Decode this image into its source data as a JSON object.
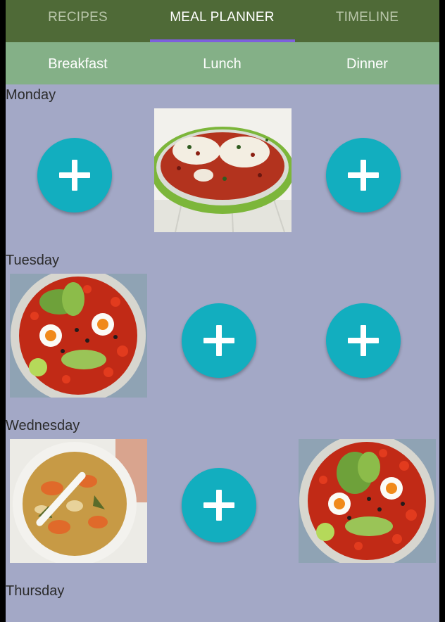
{
  "tabs": [
    {
      "label": "RECIPES",
      "active": false
    },
    {
      "label": "MEAL PLANNER",
      "active": true
    },
    {
      "label": "TIMELINE",
      "active": false
    }
  ],
  "meals": [
    "Breakfast",
    "Lunch",
    "Dinner"
  ],
  "days": [
    {
      "name": "Monday",
      "slots": [
        "add-icon",
        "fish-stew-photo",
        "add-icon"
      ]
    },
    {
      "name": "Tuesday",
      "slots": [
        "shakshuka-photo",
        "add-icon",
        "add-icon"
      ]
    },
    {
      "name": "Wednesday",
      "slots": [
        "casserole-photo",
        "add-icon",
        "shakshuka-photo"
      ]
    },
    {
      "name": "Thursday",
      "slots": []
    }
  ],
  "colors": {
    "tabbar": "#4f6a37",
    "indicator": "#7d5fdc",
    "mealbar": "#84b087",
    "background": "#a3a8c6",
    "fab": "#12aebf"
  }
}
